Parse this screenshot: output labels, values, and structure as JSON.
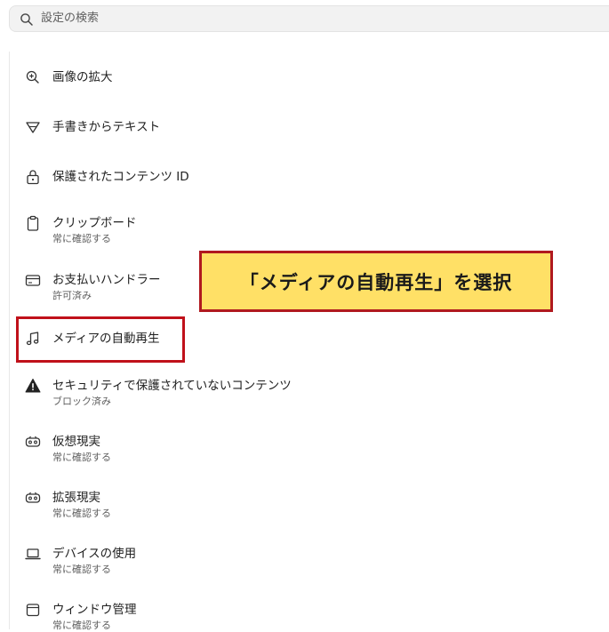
{
  "search": {
    "placeholder": "設定の検索",
    "icon": "search-icon"
  },
  "items": [
    {
      "title": "画像の拡大",
      "subtitle": "",
      "icon": "zoom-in-icon"
    },
    {
      "title": "手書きからテキスト",
      "subtitle": "",
      "icon": "handwriting-icon"
    },
    {
      "title": "保護されたコンテンツ ID",
      "subtitle": "",
      "icon": "lock-icon"
    },
    {
      "title": "クリップボード",
      "subtitle": "常に確認する",
      "icon": "clipboard-icon"
    },
    {
      "title": "お支払いハンドラー",
      "subtitle": "許可済み",
      "icon": "credit-card-icon"
    },
    {
      "title": "メディアの自動再生",
      "subtitle": "",
      "icon": "music-note-icon"
    },
    {
      "title": "セキュリティで保護されていないコンテンツ",
      "subtitle": "ブロック済み",
      "icon": "warning-icon"
    },
    {
      "title": "仮想現実",
      "subtitle": "常に確認する",
      "icon": "vr-headset-icon"
    },
    {
      "title": "拡張現実",
      "subtitle": "常に確認する",
      "icon": "ar-headset-icon"
    },
    {
      "title": "デバイスの使用",
      "subtitle": "常に確認する",
      "icon": "laptop-icon"
    },
    {
      "title": "ウィンドウ管理",
      "subtitle": "常に確認する",
      "icon": "window-icon"
    }
  ],
  "callout": {
    "text": "「メディアの自動再生」を選択"
  },
  "colors": {
    "highlight_border": "#c0111a",
    "callout_bg": "#ffe066"
  }
}
